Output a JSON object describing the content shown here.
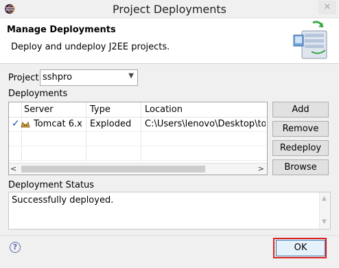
{
  "window": {
    "title": "Project Deployments",
    "close_glyph": "✕",
    "icon": "eclipse-icon"
  },
  "header": {
    "title": "Manage Deployments",
    "description": "Deploy and undeploy J2EE projects.",
    "icon": "deploy-server-icon"
  },
  "project": {
    "label": "Project",
    "selected": "sshpro"
  },
  "deployments": {
    "label": "Deployments",
    "columns": [
      "Server",
      "Type",
      "Location"
    ],
    "rows": [
      {
        "server": "Tomcat  6.x",
        "type": "Exploded",
        "location": "C:\\Users\\lenovo\\Desktop\\tool\\"
      }
    ]
  },
  "buttons": {
    "add": "Add",
    "remove": "Remove",
    "redeploy": "Redeploy",
    "browse": "Browse"
  },
  "status": {
    "label": "Deployment Status",
    "text": "Successfully deployed."
  },
  "footer": {
    "ok": "OK",
    "help": "?"
  },
  "colors": {
    "check": "#1a4fbd",
    "highlight": "#e02020"
  }
}
